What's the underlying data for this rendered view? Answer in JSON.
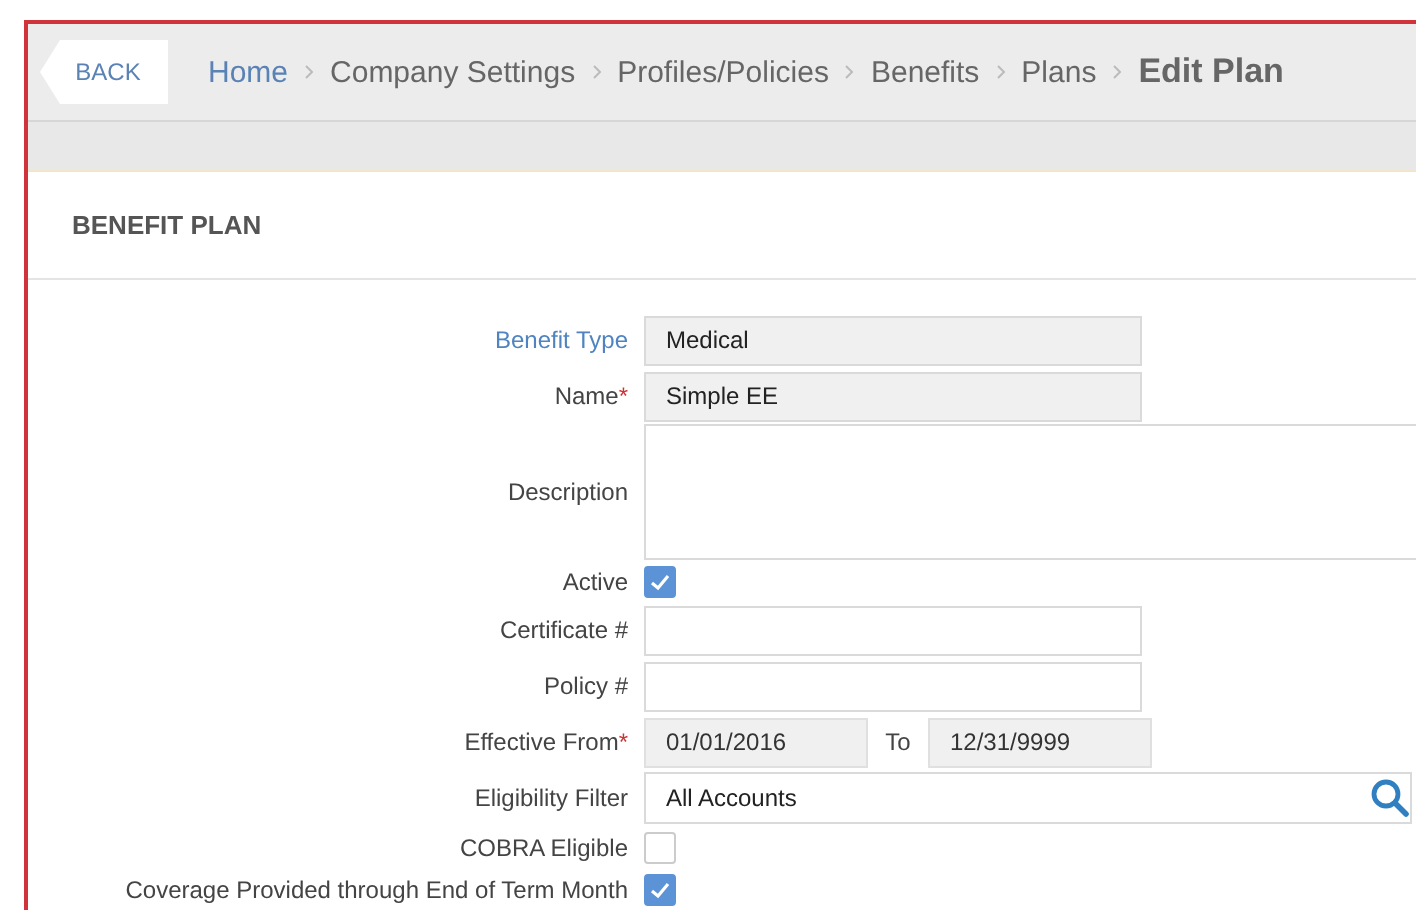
{
  "header": {
    "back_button": "BACK",
    "breadcrumbs": [
      {
        "label": "Home",
        "link": true
      },
      {
        "label": "Company Settings",
        "link": false
      },
      {
        "label": "Profiles/Policies",
        "link": false
      },
      {
        "label": "Benefits",
        "link": false
      },
      {
        "label": "Plans",
        "link": false
      }
    ],
    "current": "Edit Plan"
  },
  "section": {
    "title": "BENEFIT PLAN"
  },
  "fields": [
    {
      "kind": "text",
      "label": "Benefit Type",
      "link": true,
      "value": "Medical",
      "readonly": true
    },
    {
      "kind": "text",
      "label": "Name",
      "link": false,
      "required_mark": "*",
      "value": "Simple EE",
      "readonly": true
    },
    {
      "kind": "textarea",
      "label": "Description",
      "link": false
    },
    {
      "kind": "checkbox",
      "label": "Active",
      "link": false,
      "checked": true
    },
    {
      "kind": "text",
      "label": "Certificate #",
      "link": false,
      "readonly": false
    },
    {
      "kind": "text",
      "label": "Policy #",
      "link": false,
      "readonly": false
    },
    {
      "kind": "daterange",
      "label": "Effective From",
      "link": false,
      "required_mark": "*",
      "value": "01/01/2016",
      "separator": "To",
      "value_end": "12/31/9999"
    },
    {
      "kind": "lookup",
      "label": "Eligibility Filter",
      "link": false,
      "value": "All Accounts"
    },
    {
      "kind": "checkbox",
      "label": "COBRA Eligible",
      "link": false,
      "checked": false
    },
    {
      "kind": "checkbox",
      "label": "Coverage Provided through End of Term Month",
      "link": false,
      "checked": true
    }
  ]
}
